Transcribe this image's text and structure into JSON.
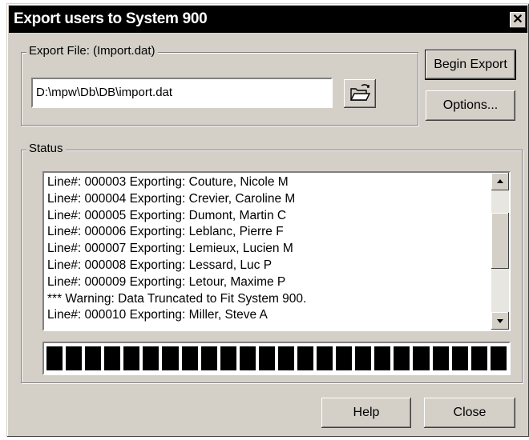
{
  "window": {
    "title": "Export users to System 900",
    "close_glyph": "✕"
  },
  "export_file": {
    "group_label": "Export File: (Import.dat)",
    "path_value": "D:\\mpw\\Db\\DB\\import.dat",
    "browse_icon": "open-folder-icon"
  },
  "buttons": {
    "begin_export_label": "Begin Export",
    "options_label": "Options...",
    "help_label": "Help",
    "close_label": "Close"
  },
  "status": {
    "group_label": "Status",
    "lines": [
      "Line#: 000003 Exporting: Couture, Nicole M",
      "Line#: 000004 Exporting: Crevier, Caroline M",
      "Line#: 000005 Exporting: Dumont, Martin C",
      "Line#: 000006 Exporting: Leblanc, Pierre F",
      "Line#: 000007 Exporting: Lemieux, Lucien M",
      "Line#: 000008 Exporting: Lessard, Luc P",
      "Line#: 000009 Exporting: Letour, Maxime P",
      "*** Warning: Data Truncated to Fit System 900.",
      "Line#: 000010 Exporting: Miller, Steve  A"
    ]
  },
  "progress": {
    "fraction": 1.0,
    "segments": 24
  }
}
